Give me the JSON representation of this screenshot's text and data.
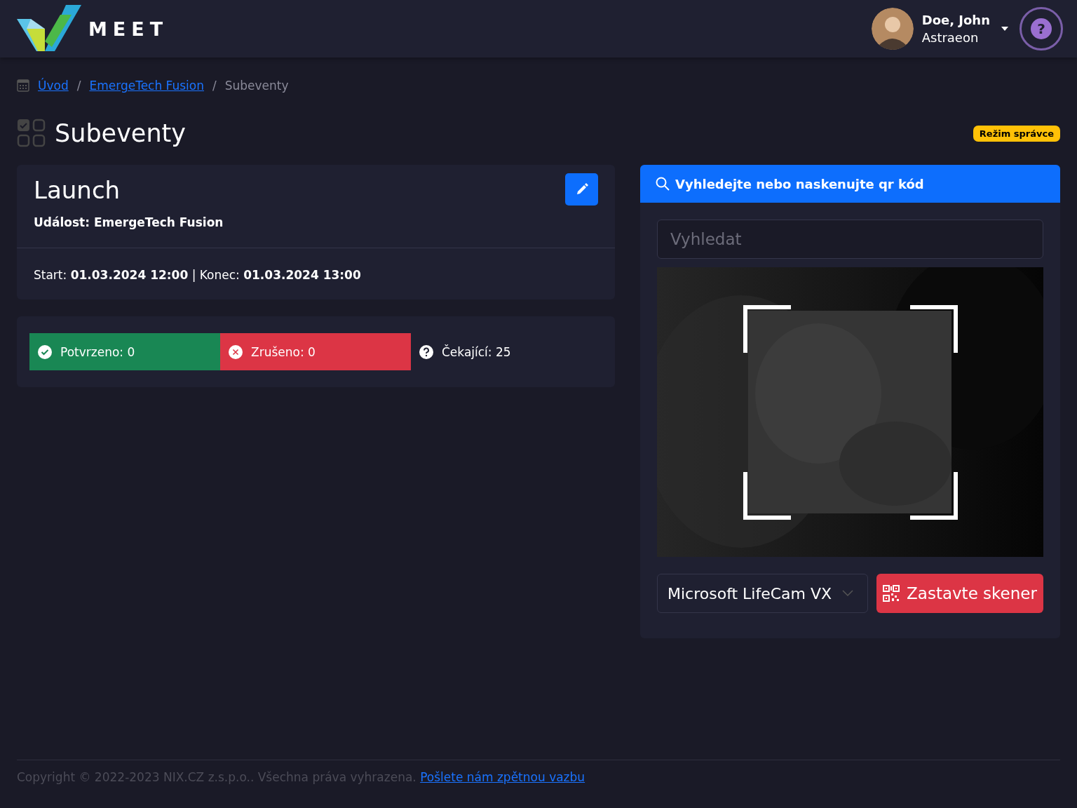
{
  "header": {
    "brand": "MEET",
    "user": {
      "name": "Doe, John",
      "organization": "Astraeon"
    },
    "help_icon": "?"
  },
  "breadcrumb": [
    {
      "label": "Úvod",
      "link": true
    },
    {
      "separator": "/"
    },
    {
      "label": "EmergeTech Fusion",
      "link": true
    },
    {
      "separator": "/"
    },
    {
      "label": "Subeventy",
      "link": false
    }
  ],
  "page_title": "Subeventy",
  "admin_badge": "Režim správce",
  "subevent": {
    "title": "Launch",
    "event_line": "Událost: EmergeTech Fusion",
    "times": "Start: **01.03.2024 12:00** | Konec: **01.03.2024 13:00**"
  },
  "attendance": [
    {
      "kind": "confirmed",
      "label": "Potvrzeno: 0"
    },
    {
      "kind": "cancelled",
      "label": "Zrušeno: 0"
    },
    {
      "kind": "pending",
      "label": "Čekající: 25"
    }
  ],
  "scanner": {
    "heading": "Vyhledejte nebo naskenujte qr kód",
    "search": {
      "placeholder": "Vyhledat"
    },
    "camera_select": "Microsoft LifeCam VX",
    "stop_button": "Zastavte skener"
  },
  "footer": {
    "copyright": "Copyright © 2022-2023 NIX.CZ z.s.p.o.. Všechna práva vyhrazena.",
    "feedback_link": "Pošlete nám zpětnou vazbu"
  }
}
